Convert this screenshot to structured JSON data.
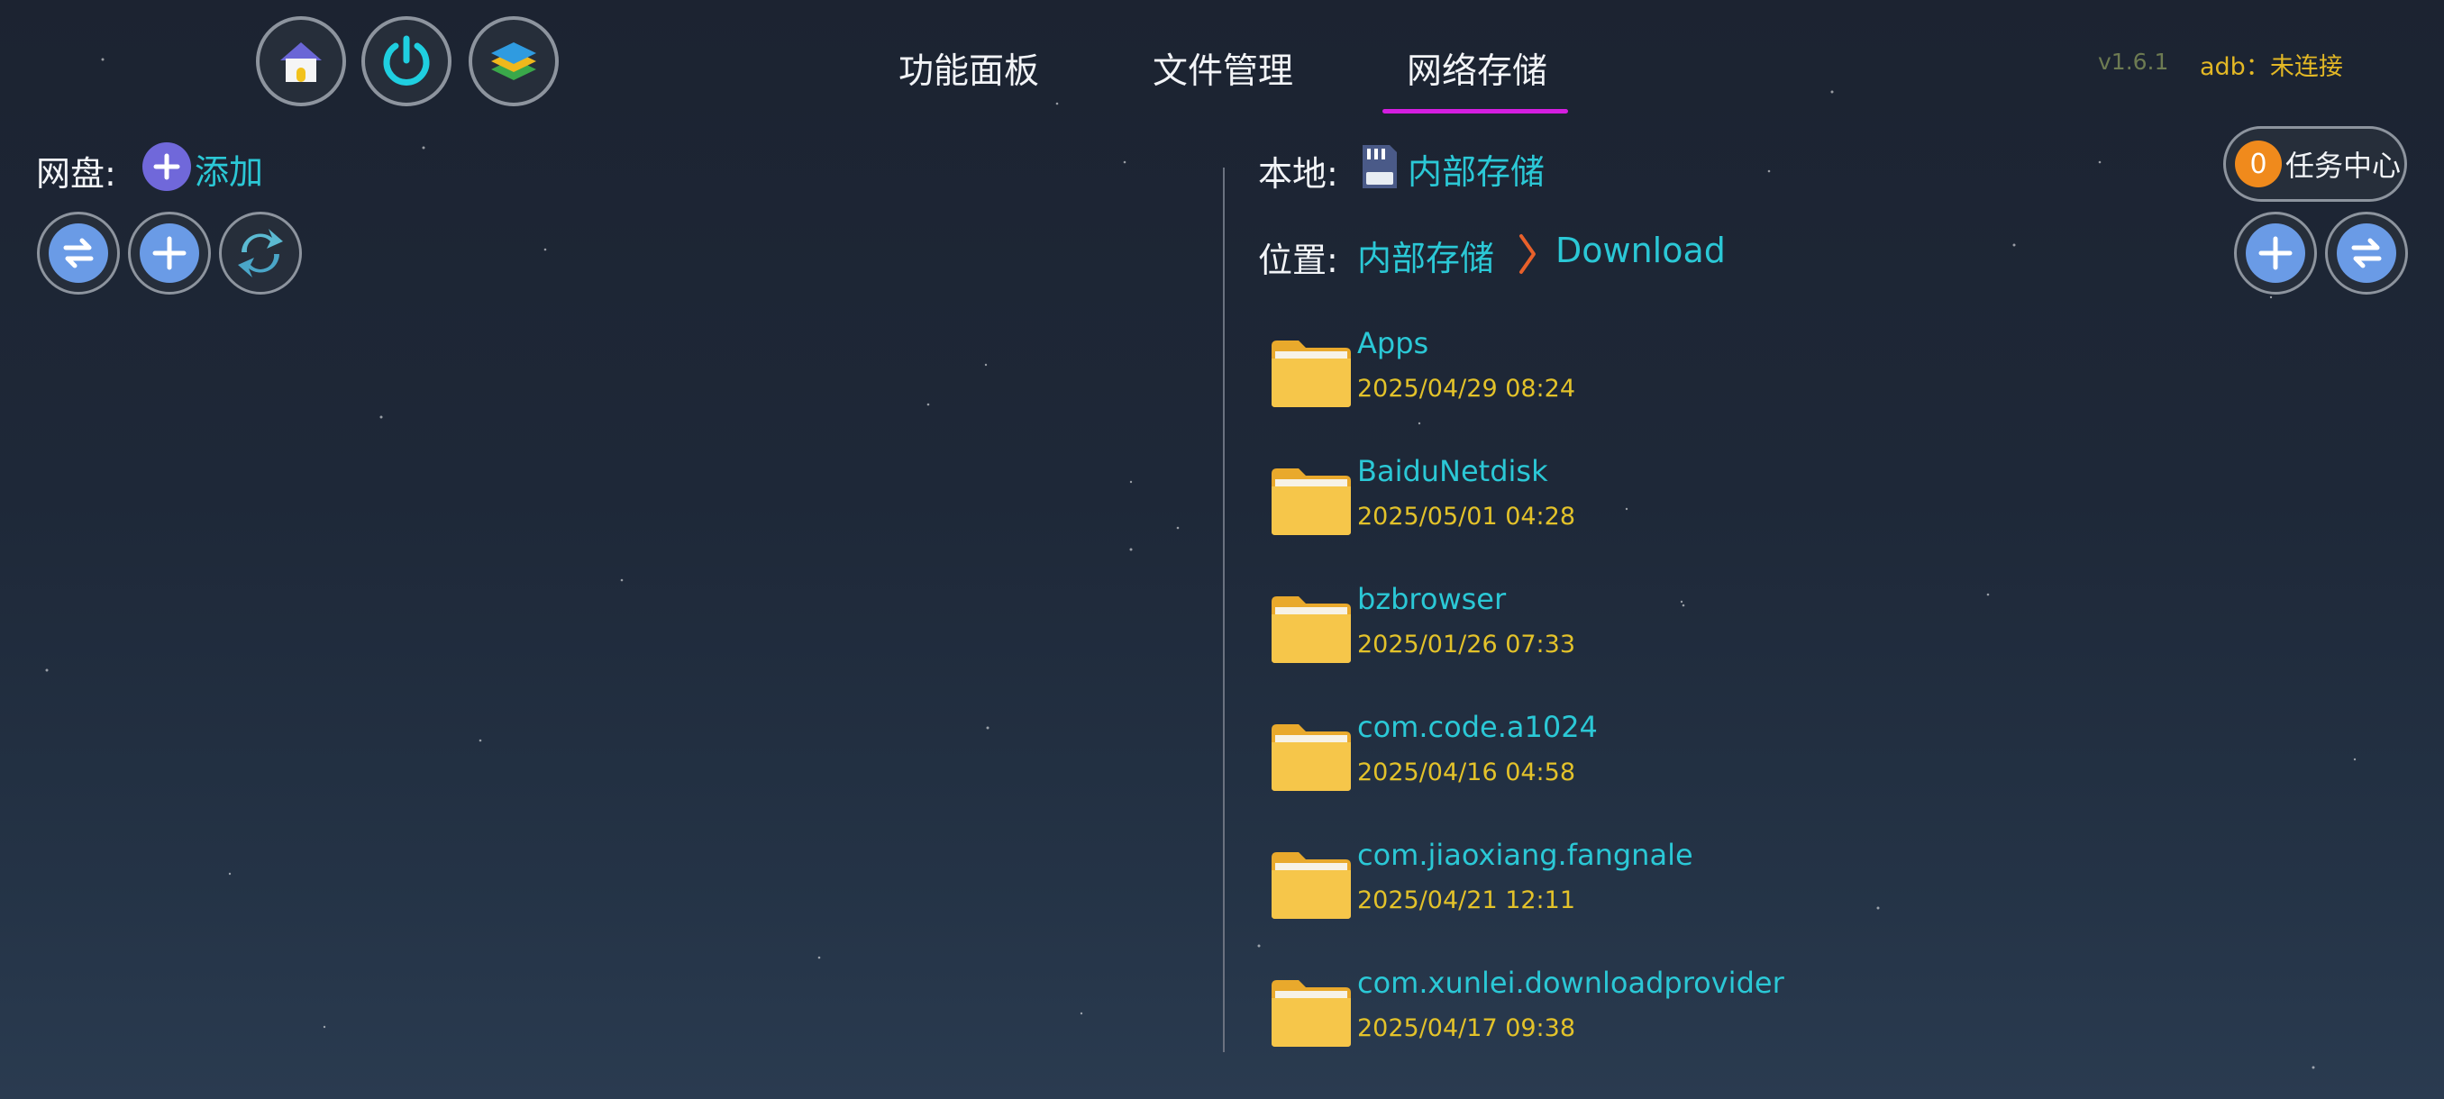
{
  "toolbar": {
    "home_icon": "home-icon",
    "power_icon": "power-icon",
    "layers_icon": "layers-icon"
  },
  "tabs": [
    {
      "label": "功能面板",
      "active": false
    },
    {
      "label": "文件管理",
      "active": false
    },
    {
      "label": "网络存储",
      "active": true
    }
  ],
  "version": "v1.6.1",
  "adb_status": "adb：未连接",
  "left_pane": {
    "label": "网盘:",
    "add_label": "添加",
    "buttons": [
      "swap-icon",
      "plus-icon",
      "refresh-icon"
    ]
  },
  "right_pane": {
    "local_label": "本地:",
    "storage_name": "内部存储",
    "location_label": "位置:",
    "breadcrumb": [
      "内部存储",
      "Download"
    ],
    "task_center": {
      "count": "0",
      "label": "任务中心"
    },
    "buttons": [
      "plus-icon",
      "swap-icon"
    ],
    "files": [
      {
        "name": "Apps",
        "date": "2025/04/29 08:24"
      },
      {
        "name": "BaiduNetdisk",
        "date": "2025/05/01 04:28"
      },
      {
        "name": "bzbrowser",
        "date": "2025/01/26 07:33"
      },
      {
        "name": "com.code.a1024",
        "date": "2025/04/16 04:58"
      },
      {
        "name": "com.jiaoxiang.fangnale",
        "date": "2025/04/21 12:11"
      },
      {
        "name": "com.xunlei.downloadprovider",
        "date": "2025/04/17 09:38"
      }
    ]
  },
  "colors": {
    "accent_cyan": "#2bc8d6",
    "date_yellow": "#e3c22a",
    "tab_underline": "#d41ee0",
    "task_badge": "#f08a1c",
    "button_blue": "#6a9be6"
  }
}
